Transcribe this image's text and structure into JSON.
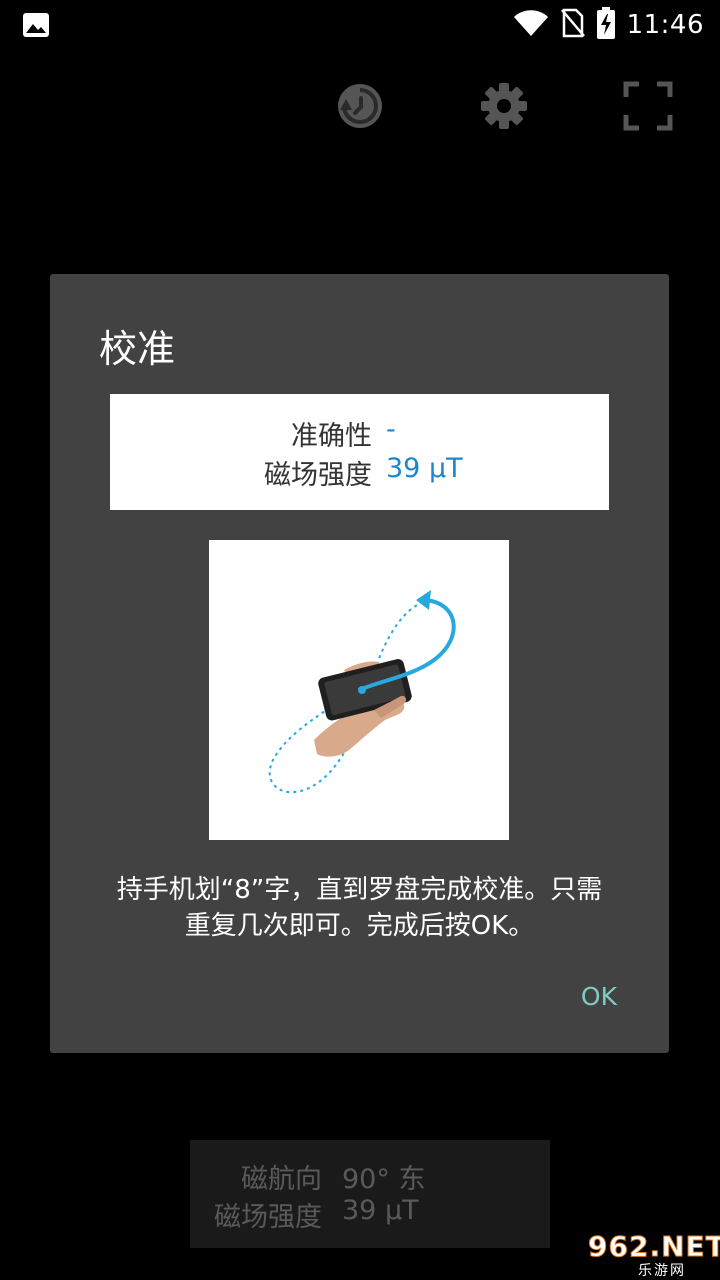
{
  "status_bar": {
    "time": "11:46",
    "icons": [
      "image-notification-icon",
      "wifi-icon",
      "no-sim-icon",
      "battery-charging-icon"
    ]
  },
  "toolbar": {
    "icons": [
      "history-icon",
      "settings-gear-icon",
      "fullscreen-icon"
    ]
  },
  "dialog": {
    "title": "校准",
    "accuracy_label": "准确性",
    "accuracy_value": "-",
    "field_strength_label": "磁场强度",
    "field_strength_value": "39 μT",
    "instructions_line1": "持手机划“8”字，直到罗盘完成校准。只需",
    "instructions_line2": "重复几次即可。完成后按OK。",
    "ok_label": "OK"
  },
  "background_panel": {
    "heading_label": "磁航向",
    "heading_value": "90° 东",
    "field_strength_label": "磁场强度",
    "field_strength_value": "39 μT"
  },
  "watermark": {
    "text": "962.NET",
    "subtext": "乐游网"
  },
  "colors": {
    "dialog_bg": "#424242",
    "accent_value": "#1a88c9",
    "ok_button": "#80cbc4",
    "figure8_path": "#29a8e0"
  }
}
